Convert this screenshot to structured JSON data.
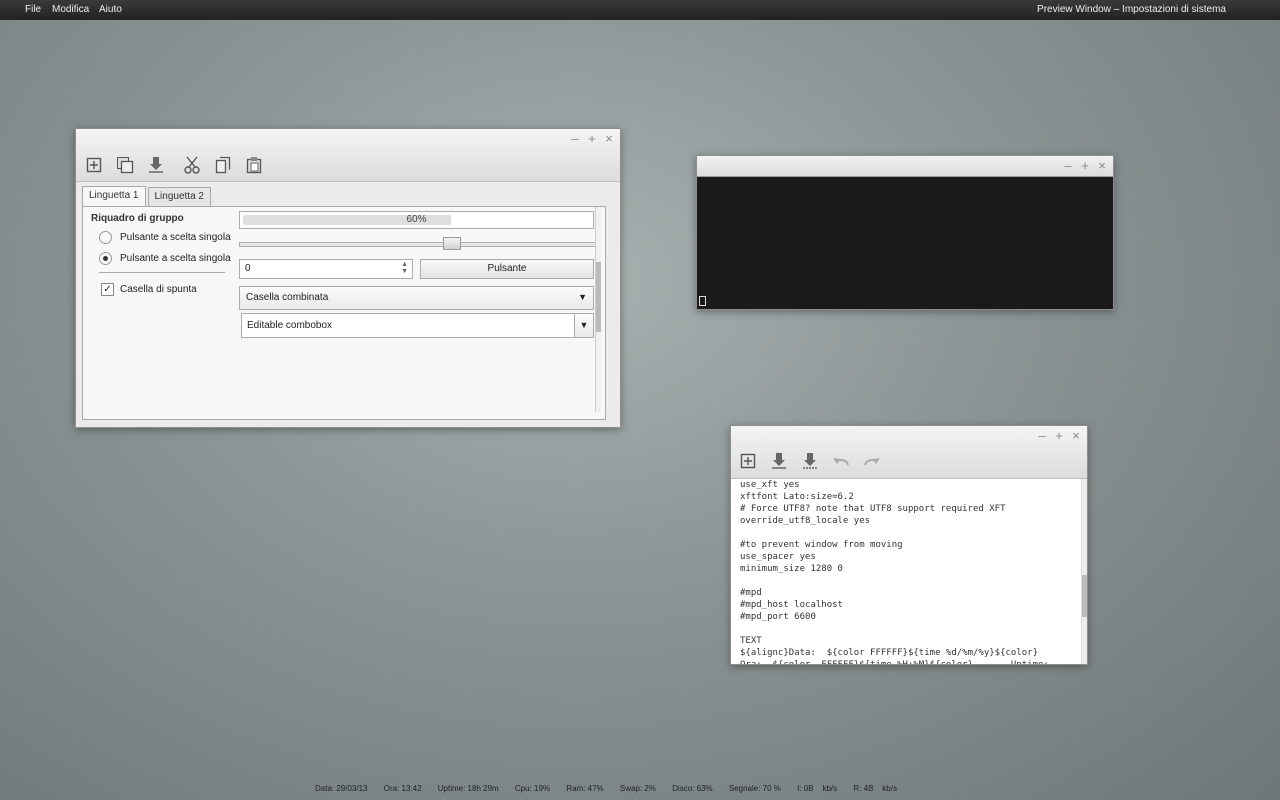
{
  "topbar": {
    "menu": [
      "File",
      "Modifica",
      "Aiuto"
    ],
    "window_title": "Preview Window – Impostazioni di sistema"
  },
  "window_controls": {
    "minimize": "–",
    "maximize": "+",
    "close": "×"
  },
  "win1": {
    "toolbar_icons": [
      "new-icon",
      "copy-window-icon",
      "download-icon",
      "cut-icon",
      "copy-icon",
      "paste-icon"
    ],
    "tabs": [
      "Linguetta 1",
      "Linguetta 2"
    ],
    "group_title": "Riquadro di gruppo",
    "radio1": "Pulsante a scelta singola",
    "radio2": "Pulsante a scelta singola",
    "checkbox_label": "Casella di spunta",
    "checkbox_mark": "✓",
    "progress_text": "60%",
    "progress_value": 0.6,
    "slider_value": 0.6,
    "spin_value": "0",
    "button_label": "Pulsante",
    "combo_value": "Casella combinata",
    "editable_combo_value": "Editable combobox"
  },
  "win3": {
    "toolbar_icons": [
      "new-icon",
      "download-icon",
      "save-icon",
      "undo-icon",
      "redo-icon"
    ],
    "lines": [
      "use_xft yes",
      "xftfont Lato:size=6.2",
      "# Force UTF8? note that UTF8 support required XFT",
      "override_utf8_locale yes",
      "",
      "#to prevent window from moving",
      "use_spacer yes",
      "minimum_size 1280 0",
      "",
      "#mpd",
      "#mpd_host localhost",
      "#mpd_port 6600",
      "",
      "TEXT",
      "${alignc}Data:  ${color FFFFFF}${time %d/%m/%y}${color}",
      "Ora:  ${color  FFFFFF}${time %H:%M}${color}       Uptime:"
    ]
  },
  "statusbar": {
    "data": "Data: 29/03/13",
    "ora": "Ora: 13:42",
    "uptime": "Uptime: 18h 29m",
    "cpu": "Cpu: 19%",
    "ram": "Ram: 47%",
    "swap": "Swap: 2%",
    "disco": "Disco: 63%",
    "segnale": "Segnale: 70 %",
    "in": "I: 0B    kb/s",
    "out": "R: 4B    kb/s"
  }
}
